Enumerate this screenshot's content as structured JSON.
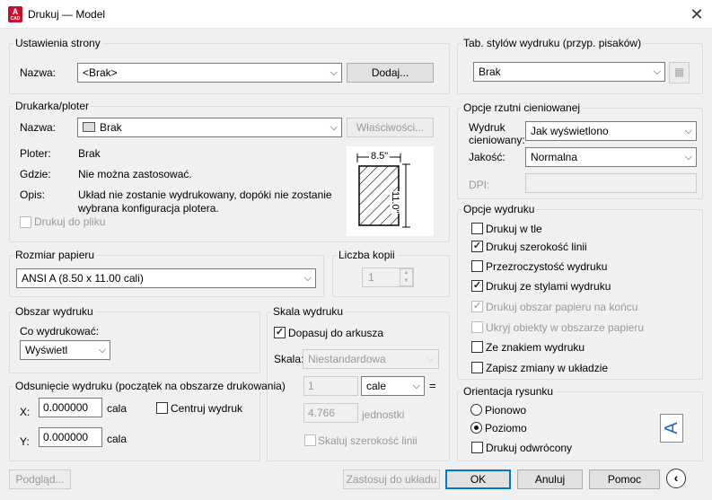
{
  "window": {
    "title": "Drukuj — Model",
    "icon_label": "A",
    "icon_sub": "CAD"
  },
  "page_setup": {
    "legend": "Ustawienia strony",
    "name_label": "Nazwa:",
    "name_value": "<Brak>",
    "add_button": "Dodaj..."
  },
  "printer": {
    "legend": "Drukarka/ploter",
    "name_label": "Nazwa:",
    "name_value": "Brak",
    "properties_button": "Właściwości...",
    "plotter_label": "Ploter:",
    "plotter_value": "Brak",
    "where_label": "Gdzie:",
    "where_value": "Nie można zastosować.",
    "desc_label": "Opis:",
    "desc_line1": "Układ nie zostanie wydrukowany, dopóki nie zostanie",
    "desc_line2": "wybrana konfiguracja plotera.",
    "print_to_file": "Drukuj do pliku",
    "preview_width": "8.5\"",
    "preview_height": "11.0\""
  },
  "paper_size": {
    "legend": "Rozmiar papieru",
    "value": "ANSI A (8.50 x 11.00 cali)"
  },
  "copies": {
    "legend": "Liczba kopii",
    "value": "1"
  },
  "plot_area": {
    "legend": "Obszar wydruku",
    "what_label": "Co wydrukować:",
    "what_value": "Wyświetl"
  },
  "plot_offset": {
    "legend": "Odsunięcie wydruku (początek na obszarze drukowania)",
    "x_label": "X:",
    "x_value": "0.000000",
    "x_unit": "cala",
    "y_label": "Y:",
    "y_value": "0.000000",
    "y_unit": "cala",
    "center_label": "Centruj wydruk"
  },
  "plot_scale": {
    "legend": "Skala wydruku",
    "fit_label": "Dopasuj do arkusza",
    "scale_label": "Skala:",
    "scale_value": "Niestandardowa",
    "value1": "1",
    "unit1": "cale",
    "equals": "=",
    "value2": "4.766",
    "unit2": "jednostki",
    "scale_lineweights": "Skaluj szerokość linii"
  },
  "plot_style_table": {
    "legend": "Tab. stylów wydruku (przyp. pisaków)",
    "value": "Brak"
  },
  "shaded_viewport": {
    "legend": "Opcje rzutni cieniowanej",
    "shade_label_1": "Wydruk",
    "shade_label_2": "cieniowany:",
    "shade_value": "Jak wyświetlono",
    "quality_label": "Jakość:",
    "quality_value": "Normalna",
    "dpi_label": "DPI:"
  },
  "plot_options": {
    "legend": "Opcje wydruku",
    "items": [
      {
        "label": "Drukuj w tle",
        "mark": ""
      },
      {
        "label": "Drukuj szerokość linii",
        "mark": "✓"
      },
      {
        "label": "Przezroczystość wydruku",
        "mark": ""
      },
      {
        "label": "Drukuj ze stylami wydruku",
        "mark": "✓"
      },
      {
        "label": "Drukuj obszar papieru na końcu",
        "mark": "✓"
      },
      {
        "label": "Ukryj obiekty w obszarze papieru",
        "mark": ""
      },
      {
        "label": "Ze znakiem wydruku",
        "mark": ""
      },
      {
        "label": "Zapisz zmiany w układzie",
        "mark": ""
      }
    ]
  },
  "orientation": {
    "legend": "Orientacja rysunku",
    "portrait": "Pionowo",
    "landscape": "Poziomo",
    "upside_down": "Drukuj odwrócony",
    "icon_letter": "A"
  },
  "footer": {
    "preview": "Podgląd...",
    "apply": "Zastosuj do układu",
    "ok": "OK",
    "cancel": "Anuluj",
    "help": "Pomoc"
  }
}
